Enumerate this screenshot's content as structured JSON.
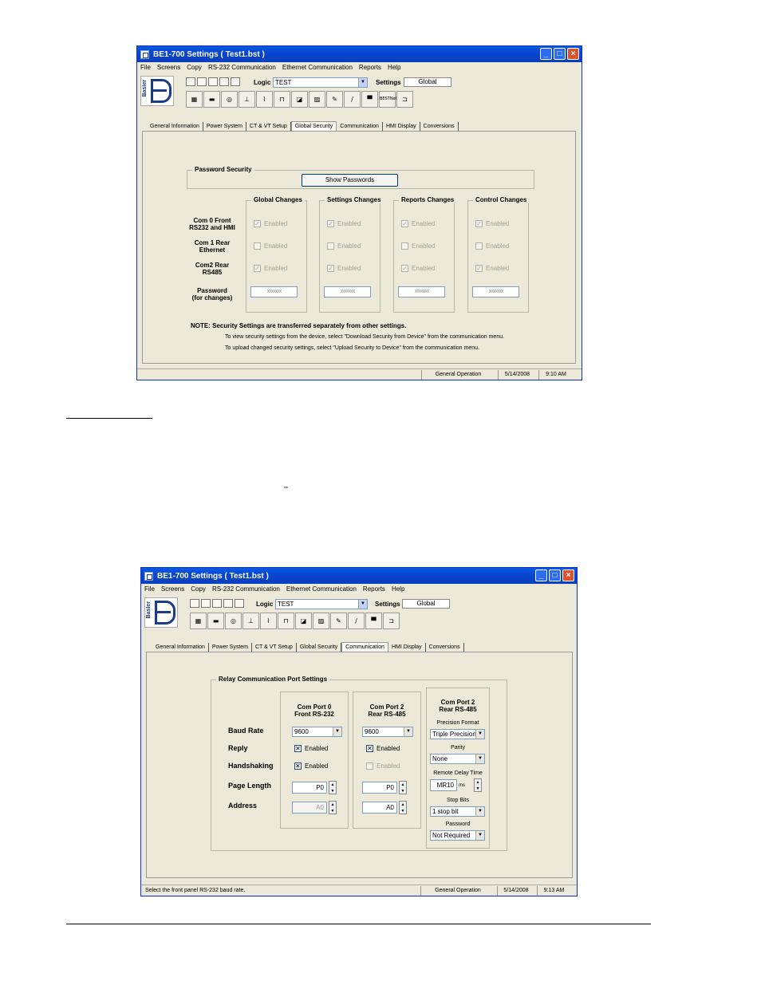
{
  "window1": {
    "title": "BE1-700 Settings   ( Test1.bst )",
    "menu": [
      "File",
      "Screens",
      "Copy",
      "RS-232 Communication",
      "Ethernet Communication",
      "Reports",
      "Help"
    ],
    "toolbar": {
      "logo_text": "Basler",
      "logic_label": "Logic",
      "logic_value": "TEST",
      "settings_label": "Settings",
      "settings_value": "Global",
      "bestnet_label": "BESTNet"
    },
    "tabs": [
      "General Information",
      "Power System",
      "CT & VT Setup",
      "Global Security",
      "Communication",
      "HMI Display",
      "Conversions"
    ],
    "active_tab": "Global Security",
    "password_security": {
      "title": "Password Security",
      "show_button": "Show Passwords",
      "columns": [
        "Global Changes",
        "Settings Changes",
        "Reports Changes",
        "Control Changes"
      ],
      "rows": [
        {
          "label_line1": "Com 0 Front",
          "label_line2": "RS232 and HMI",
          "checked": [
            true,
            true,
            true,
            true
          ]
        },
        {
          "label_line1": "Com 1 Rear",
          "label_line2": "Ethernet",
          "checked": [
            false,
            false,
            false,
            false
          ]
        },
        {
          "label_line1": "Com2 Rear",
          "label_line2": "RS485",
          "checked": [
            true,
            true,
            true,
            true
          ]
        }
      ],
      "enabled_label": "Enabled",
      "password_label_line1": "Password",
      "password_label_line2": "(for changes)",
      "password_masks": [
        "xxxxxxx",
        "xxxxxxx",
        "xxxxxxx",
        "xxxxxxx"
      ],
      "note": "NOTE: Security Settings are transferred separately from other settings.",
      "note_line1": "To view security settings from the device, select \"Download Security from Device\" from the communication menu.",
      "note_line2": "To upload changed security settings, select \"Upload Security to Device\" from the communication menu."
    },
    "status": {
      "message": "",
      "mode": "General Operation",
      "date": "5/14/2008",
      "time": "9:10 AM"
    }
  },
  "window2": {
    "title": "BE1-700 Settings   ( Test1.bst )",
    "menu": [
      "File",
      "Screens",
      "Copy",
      "RS-232 Communication",
      "Ethernet Communication",
      "Reports",
      "Help"
    ],
    "toolbar": {
      "logo_text": "Basler",
      "logic_label": "Logic",
      "logic_value": "TEST",
      "settings_label": "Settings",
      "settings_value": "Global"
    },
    "tabs": [
      "General Information",
      "Power System",
      "CT & VT Setup",
      "Global Security",
      "Communication",
      "HMI Display",
      "Conversions"
    ],
    "active_tab": "Communication",
    "relay_comm": {
      "title": "Relay Communication Port Settings",
      "row_labels": [
        "Baud Rate",
        "Reply",
        "Handshaking",
        "Page Length",
        "Address"
      ],
      "com0": {
        "header_line1": "Com Port 0",
        "header_line2": "Front RS-232",
        "baud": "9600",
        "reply": "Enabled",
        "reply_checked": true,
        "handshaking": "Enabled",
        "handshaking_checked": true,
        "page_length": "P0",
        "address": "A0"
      },
      "com2": {
        "header_line1": "Com Port 2",
        "header_line2": "Rear RS-485",
        "baud": "9600",
        "reply": "Enabled",
        "reply_checked": true,
        "handshaking": "Enabled",
        "handshaking_checked": false,
        "page_length": "P0",
        "address": "A0"
      },
      "com2_extra": {
        "header_line1": "Com Port 2",
        "header_line2": "Rear RS-485",
        "precision_label": "Precision Format",
        "precision_value": "Triple Precision",
        "parity_label": "Parity",
        "parity_value": "None",
        "delay_label": "Remote Delay Time",
        "delay_value": "MR10",
        "delay_unit": "ms",
        "stopbits_label": "Stop Bits",
        "stopbits_value": "1 stop bit",
        "password_label": "Password",
        "password_value": "Not Required"
      }
    },
    "status": {
      "message": "Select the front panel RS-232 baud rate.",
      "mode": "General Operation",
      "date": "5/14/2008",
      "time": "9:13 AM"
    }
  },
  "page": {
    "tm_mark": "™"
  }
}
